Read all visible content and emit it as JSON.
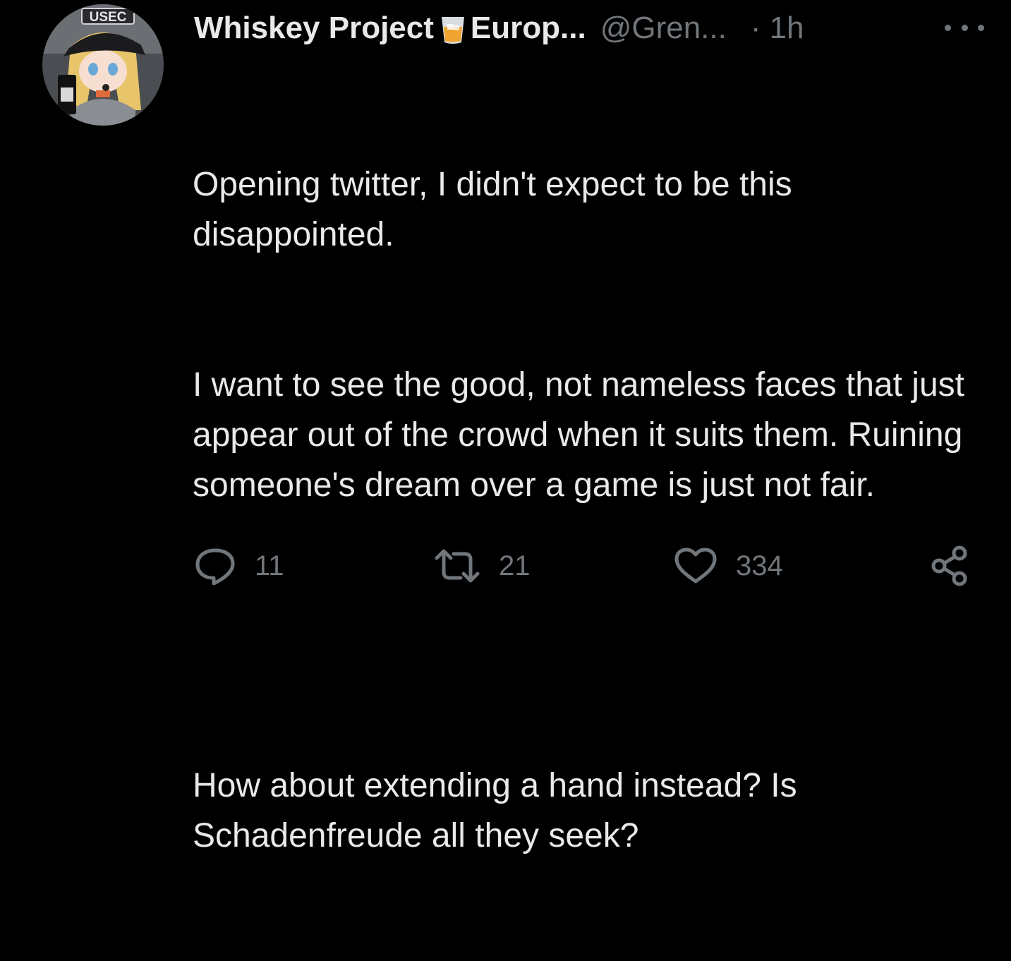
{
  "tweet": {
    "author": {
      "name_part1": "Whiskey Project",
      "name_emoji": "tumbler-glass-icon",
      "name_part2": "Europ...",
      "handle": "@Gren...",
      "separator": "·",
      "time": "1h",
      "avatar_text": "USEC"
    },
    "body": {
      "line1": "Opening twitter, I didn't expect to be this disappointed.",
      "line2": "I want to see the good, not nameless faces that just appear out of the crowd when it suits them. Ruining someone's dream over a game is just not fair.",
      "line3": "How about extending a hand instead? Is Schadenfreude all they seek?"
    },
    "actions": {
      "reply_icon": "reply-bubble-icon",
      "reply_count": "11",
      "retweet_icon": "retweet-icon",
      "retweet_count": "21",
      "like_icon": "heart-icon",
      "like_count": "334",
      "share_icon": "share-icon"
    }
  },
  "colors": {
    "background": "#000000",
    "text": "#e7e9ea",
    "muted": "#71767b"
  }
}
